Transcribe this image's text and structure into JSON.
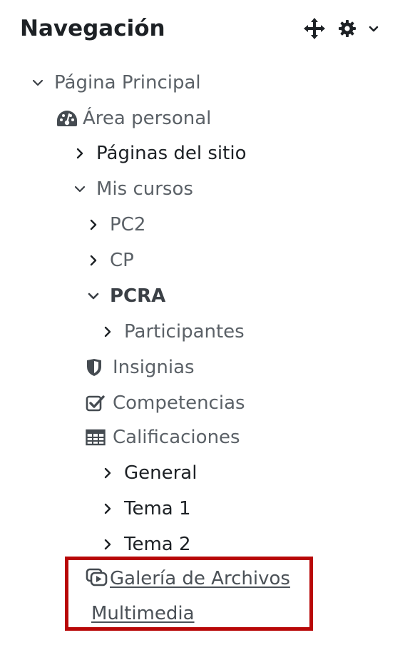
{
  "block": {
    "title": "Navegación",
    "controls": {
      "move_icon": "move-arrows-icon",
      "settings_icon": "gear-icon",
      "menu_icon": "chevron-down-icon"
    }
  },
  "nav": {
    "home": "Página Principal",
    "dashboard": "Área personal",
    "site_pages": "Páginas del sitio",
    "my_courses": "Mis cursos",
    "courses": [
      "PC2",
      "CP",
      "PCRA"
    ],
    "participants": "Participantes",
    "badges": "Insignias",
    "competencies": "Competencias",
    "grades": "Calificaciones",
    "sections": [
      "General",
      "Tema 1",
      "Tema 2"
    ],
    "media_gallery_line1": "Galería de Archivos",
    "media_gallery_line2": "Multimedia"
  },
  "colors": {
    "text": "#5b6167",
    "dark_text": "#1d2125",
    "highlight_border": "#b80707"
  }
}
